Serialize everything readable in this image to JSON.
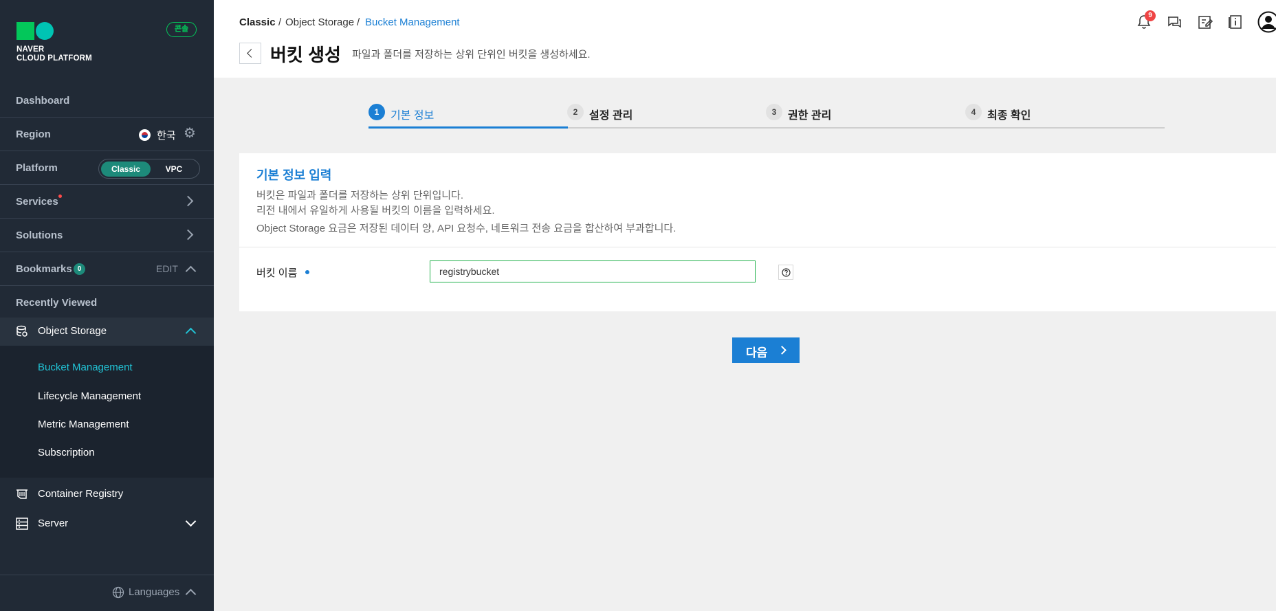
{
  "brand": {
    "line1": "NAVER",
    "line2": "CLOUD PLATFORM",
    "console_badge": "콘솔"
  },
  "sidebar": {
    "dashboard": "Dashboard",
    "region": {
      "label": "Region",
      "value": "한국"
    },
    "platform": {
      "label": "Platform",
      "options": [
        "Classic",
        "VPC"
      ],
      "selected": "Classic"
    },
    "services": "Services",
    "solutions": "Solutions",
    "bookmarks": {
      "label": "Bookmarks",
      "count": "0",
      "edit": "EDIT"
    },
    "recently_viewed": "Recently Viewed",
    "object_storage": {
      "label": "Object Storage",
      "items": [
        "Bucket Management",
        "Lifecycle Management",
        "Metric Management",
        "Subscription"
      ],
      "active": "Bucket Management"
    },
    "container_registry": "Container Registry",
    "server": "Server",
    "languages": "Languages"
  },
  "header": {
    "breadcrumb": [
      "Classic",
      "Object Storage",
      "Bucket Management"
    ],
    "separator": "/",
    "title": "버킷 생성",
    "description": "파일과 폴더를 저장하는 상위 단위인 버킷을 생성하세요.",
    "notification_count": "9"
  },
  "steps": [
    {
      "num": "1",
      "label": "기본 정보"
    },
    {
      "num": "2",
      "label": "설정 관리"
    },
    {
      "num": "3",
      "label": "권한 관리"
    },
    {
      "num": "4",
      "label": "최종 확인"
    }
  ],
  "active_step": 1,
  "form": {
    "title": "기본 정보 입력",
    "lines": [
      "버킷은 파일과 폴더를 저장하는 상위 단위입니다.",
      "리전 내에서 유일하게 사용될 버킷의 이름을 입력하세요.",
      "Object Storage 요금은 저장된 데이터 양, API 요청수, 네트워크 전송 요금을 합산하여 부과합니다."
    ],
    "bucket_name_label": "버킷 이름",
    "bucket_name_value": "registrybucket"
  },
  "next_button": "다음",
  "colors": {
    "sidebar_bg": "#212a36",
    "accent": "#1b7fd4",
    "brand_green": "#03c75a",
    "toggle_on": "#1d8a7a",
    "active_sub": "#21c4d6"
  }
}
